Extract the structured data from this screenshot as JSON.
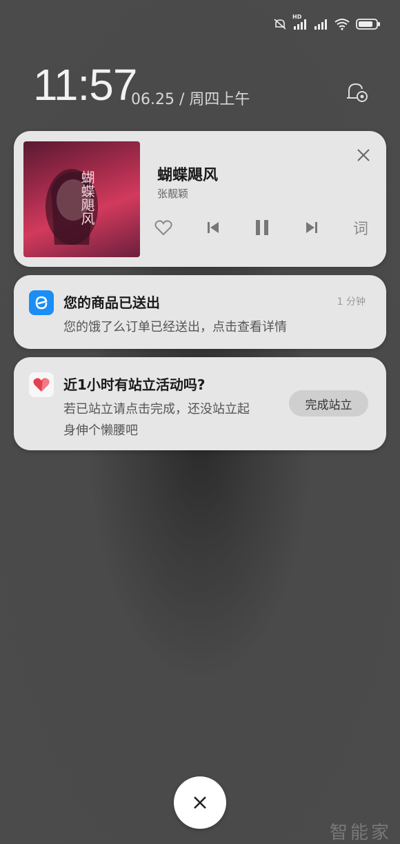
{
  "status_bar": {
    "icons": [
      "mute-icon",
      "hd-signal-icon",
      "signal-icon",
      "wifi-icon",
      "battery-icon"
    ],
    "hd_label": "HD"
  },
  "lockscreen": {
    "time": "11:57",
    "date": "06.25 / 周四上午"
  },
  "music": {
    "title": "蝴蝶飓风",
    "artist": "张靓颖",
    "lyrics_button": "词",
    "album_art_text": "蝴蝶飓风"
  },
  "notifications": [
    {
      "app": "ele-me",
      "title": "您的商品已送出",
      "body": "您的饿了么订单已经送出，点击查看详情",
      "time": "1 分钟"
    },
    {
      "app": "health",
      "title": "近1小时有站立活动吗?",
      "body_line1": "若已站立请点击完成，还没站立起",
      "body_line2": "身伸个懒腰吧",
      "action": "完成站立"
    }
  ],
  "watermark": "智能家",
  "colors": {
    "accent_blue": "#1a8ef5",
    "heart_red": "#e5404f"
  }
}
